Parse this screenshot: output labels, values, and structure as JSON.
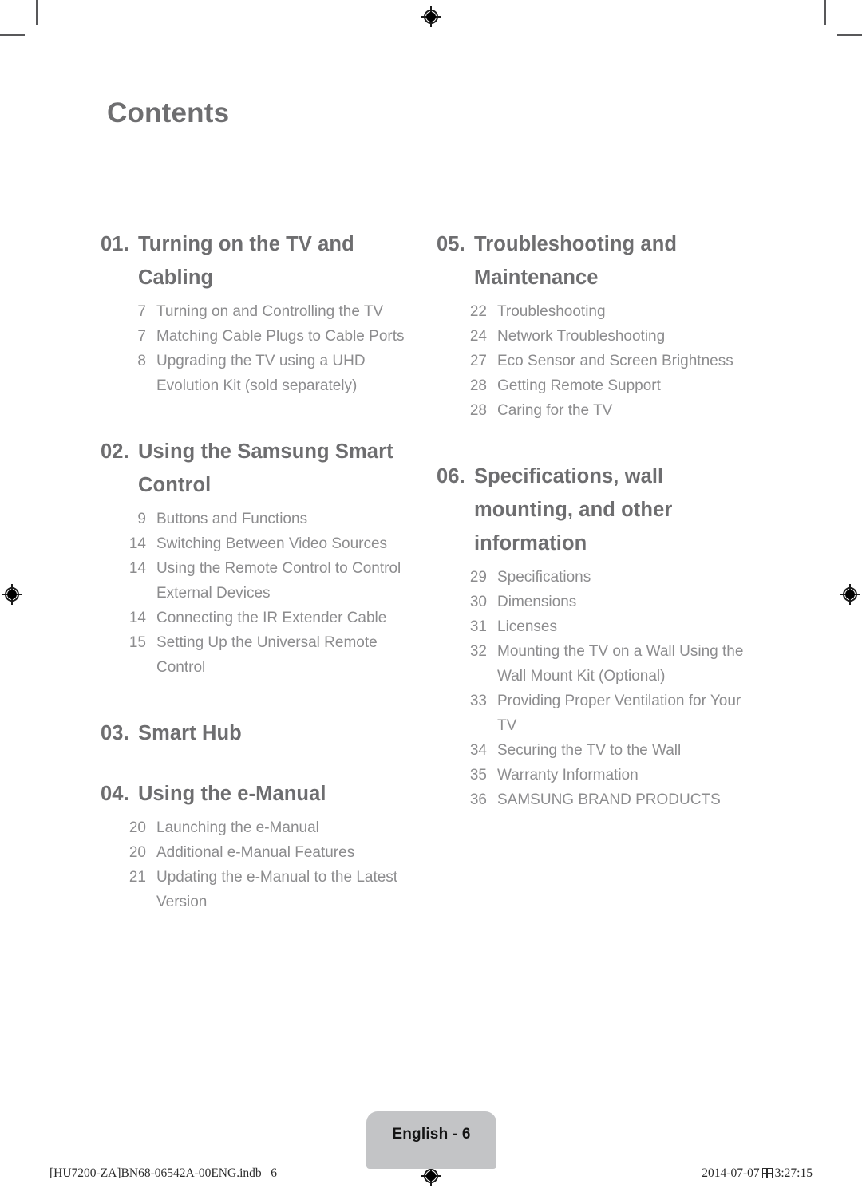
{
  "page": {
    "title": "Contents",
    "language_tab": "English - 6",
    "imprint": "[HU7200-ZA]BN68-06542A-00ENG.indb   6",
    "timestamp_date": "2014-07-07",
    "timestamp_time": "3:27:15",
    "colors": {
      "heading": "#6e6e70",
      "entry": "#8c8c8e",
      "tab_background": "#c3c4c6",
      "crop_mark": "#58585a"
    }
  },
  "columns": {
    "left": [
      {
        "number": "01.",
        "title": "Turning on the TV and Cabling",
        "entries": [
          {
            "page": "7",
            "title": "Turning on and Controlling the TV"
          },
          {
            "page": "7",
            "title": "Matching Cable Plugs to Cable Ports"
          },
          {
            "page": "8",
            "title": "Upgrading the TV using a UHD Evolution Kit (sold separately)"
          }
        ]
      },
      {
        "number": "02.",
        "title": "Using the Samsung Smart Control",
        "entries": [
          {
            "page": "9",
            "title": "Buttons and Functions"
          },
          {
            "page": "14",
            "title": "Switching Between Video Sources"
          },
          {
            "page": "14",
            "title": "Using the Remote Control to Control External Devices"
          },
          {
            "page": "14",
            "title": "Connecting the IR Extender Cable"
          },
          {
            "page": "15",
            "title": "Setting Up the Universal Remote Control"
          }
        ]
      },
      {
        "number": "03.",
        "title": "Smart Hub",
        "entries": []
      },
      {
        "number": "04.",
        "title": "Using the e-Manual",
        "entries": [
          {
            "page": "20",
            "title": "Launching the e-Manual"
          },
          {
            "page": "20",
            "title": "Additional e-Manual Features"
          },
          {
            "page": "21",
            "title": "Updating the e-Manual to the Latest Version"
          }
        ]
      }
    ],
    "right": [
      {
        "number": "05.",
        "title": "Troubleshooting and Maintenance",
        "entries": [
          {
            "page": "22",
            "title": "Troubleshooting"
          },
          {
            "page": "24",
            "title": "Network Troubleshooting"
          },
          {
            "page": "27",
            "title": "Eco Sensor and Screen Brightness"
          },
          {
            "page": "28",
            "title": "Getting Remote Support"
          },
          {
            "page": "28",
            "title": "Caring for the TV"
          }
        ]
      },
      {
        "number": "06.",
        "title": "Specifications, wall mounting, and other information",
        "entries": [
          {
            "page": "29",
            "title": "Specifications"
          },
          {
            "page": "30",
            "title": "Dimensions"
          },
          {
            "page": "31",
            "title": "Licenses"
          },
          {
            "page": "32",
            "title": "Mounting the TV on a Wall Using the Wall Mount Kit (Optional)"
          },
          {
            "page": "33",
            "title": "Providing Proper Ventilation for Your TV"
          },
          {
            "page": "34",
            "title": "Securing the TV to the Wall"
          },
          {
            "page": "35",
            "title": "Warranty Information"
          },
          {
            "page": "36",
            "title": "SAMSUNG BRAND PRODUCTS"
          }
        ]
      }
    ]
  }
}
